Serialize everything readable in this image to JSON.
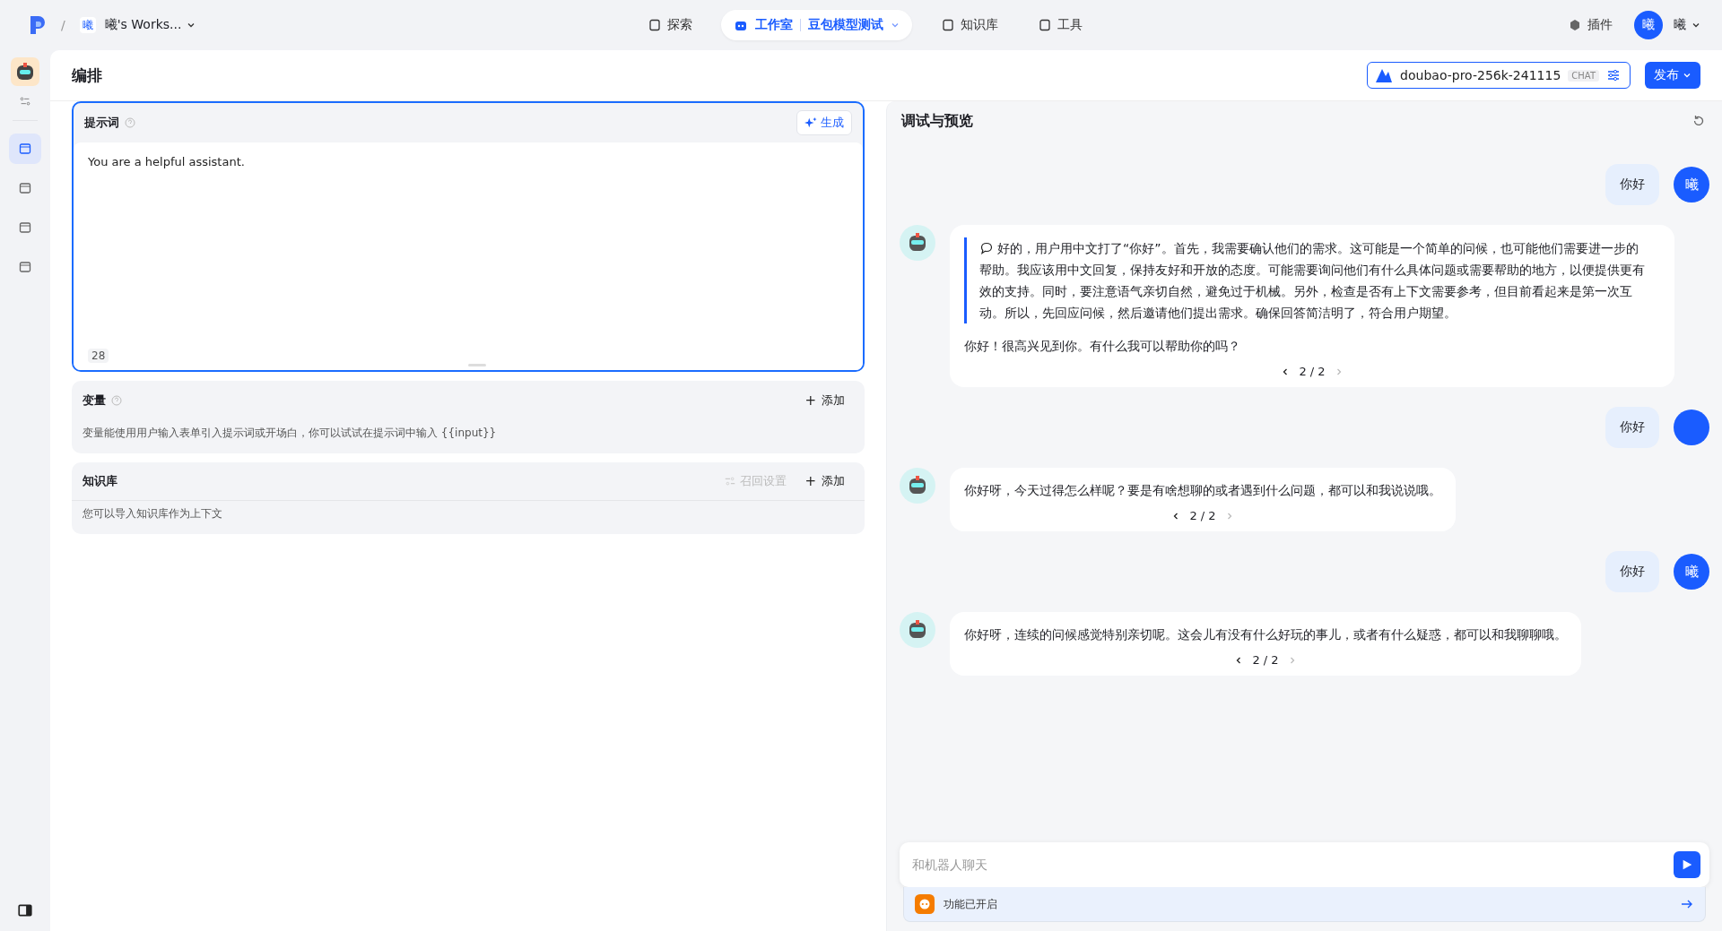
{
  "topbar": {
    "separator": "/",
    "workspace_badge": "曦",
    "workspace": "曦's Works...",
    "nav": [
      {
        "kind": "link",
        "label": "探索",
        "selected": false
      },
      {
        "kind": "studio",
        "label": "工作室",
        "sub": "豆包模型测试",
        "selected": true
      },
      {
        "kind": "link",
        "label": "知识库",
        "selected": false
      },
      {
        "kind": "link",
        "label": "工具",
        "selected": false
      }
    ],
    "plugin": "插件",
    "avatar": "曦",
    "user": "曦"
  },
  "rail": {
    "items": [
      {
        "selected": true
      },
      {
        "selected": false
      },
      {
        "selected": false
      },
      {
        "selected": false
      }
    ]
  },
  "editor": {
    "title": "编排",
    "model": "doubao-pro-256k-241115",
    "model_tag": "CHAT",
    "publish": "发布",
    "prompt": {
      "title": "提示词",
      "generate": "生成",
      "value": "You are a helpful assistant.",
      "count": "28"
    },
    "variables": {
      "title": "变量",
      "plus": "+",
      "add": "添加",
      "hint": "变量能使用用户输入表单引入提示词或开场白，你可以试试在提示词中输入 {{input}}"
    },
    "knowledge": {
      "title": "知识库",
      "recall": "召回设置",
      "plus": "+",
      "add": "添加",
      "hint": "您可以导入知识库作为上下文"
    }
  },
  "preview": {
    "title": "调试与预览",
    "messages": [
      {
        "kind": "user",
        "text": "你好",
        "avatar": "曦"
      },
      {
        "kind": "bot",
        "thinking": "好的，用户用中文打了“你好”。首先，我需要确认他们的需求。这可能是一个简单的问候，也可能他们需要进一步的帮助。我应该用中文回复，保持友好和开放的态度。可能需要询问他们有什么具体问题或需要帮助的地方，以便提供更有效的支持。同时，要注意语气亲切自然，避免过于机械。另外，检查是否有上下文需要参考，但目前看起来是第一次互动。所以，先回应问候，然后邀请他们提出需求。确保回答简洁明了，符合用户期望。",
        "text": "你好！很高兴见到你。有什么我可以帮助你的吗？",
        "pager": "2 / 2"
      },
      {
        "kind": "user",
        "text": "你好"
      },
      {
        "kind": "bot",
        "text": "你好呀，今天过得怎么样呢？要是有啥想聊的或者遇到什么问题，都可以和我说说哦。",
        "pager": "2 / 2"
      },
      {
        "kind": "user",
        "text": "你好",
        "avatar": "曦"
      },
      {
        "kind": "bot",
        "text": "你好呀，连续的问候感觉特别亲切呢。这会儿有没有什么好玩的事儿，或者有什么疑惑，都可以和我聊聊哦。",
        "pager": "2 / 2"
      }
    ],
    "input": {
      "placeholder": "和机器人聊天"
    },
    "feature": "功能已开启"
  }
}
